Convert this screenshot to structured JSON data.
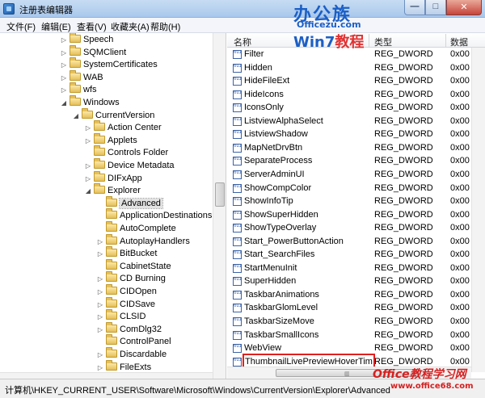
{
  "window": {
    "title": "注册表编辑器",
    "minimize_glyph": "—",
    "maximize_glyph": "□",
    "close_glyph": "✕"
  },
  "watermark": {
    "logo_top": "办公族",
    "logo_url": "Officezu.com",
    "logo_win7": "Win7",
    "logo_win7_suffix": "教程",
    "bottom_brand": "Office教程学习网",
    "bottom_url": "www.office68.com"
  },
  "menu": [
    "文件(F)",
    "编辑(E)",
    "查看(V)",
    "收藏夹(A)",
    "帮助(H)"
  ],
  "tree": [
    {
      "label": "Speech",
      "depth": 0,
      "arrow": "▷"
    },
    {
      "label": "SQMClient",
      "depth": 0,
      "arrow": "▷"
    },
    {
      "label": "SystemCertificates",
      "depth": 0,
      "arrow": "▷"
    },
    {
      "label": "WAB",
      "depth": 0,
      "arrow": "▷"
    },
    {
      "label": "wfs",
      "depth": 0,
      "arrow": "▷"
    },
    {
      "label": "Windows",
      "depth": 0,
      "arrow": "◢"
    },
    {
      "label": "CurrentVersion",
      "depth": 1,
      "arrow": "◢"
    },
    {
      "label": "Action Center",
      "depth": 2,
      "arrow": "▷"
    },
    {
      "label": "Applets",
      "depth": 2,
      "arrow": "▷"
    },
    {
      "label": "Controls Folder",
      "depth": 2,
      "arrow": ""
    },
    {
      "label": "Device Metadata",
      "depth": 2,
      "arrow": "▷"
    },
    {
      "label": "DIFxApp",
      "depth": 2,
      "arrow": "▷"
    },
    {
      "label": "Explorer",
      "depth": 2,
      "arrow": "◢"
    },
    {
      "label": "Advanced",
      "depth": 3,
      "arrow": "",
      "selected": true
    },
    {
      "label": "ApplicationDestinations",
      "depth": 3,
      "arrow": ""
    },
    {
      "label": "AutoComplete",
      "depth": 3,
      "arrow": ""
    },
    {
      "label": "AutoplayHandlers",
      "depth": 3,
      "arrow": "▷"
    },
    {
      "label": "BitBucket",
      "depth": 3,
      "arrow": "▷"
    },
    {
      "label": "CabinetState",
      "depth": 3,
      "arrow": ""
    },
    {
      "label": "CD Burning",
      "depth": 3,
      "arrow": "▷"
    },
    {
      "label": "CIDOpen",
      "depth": 3,
      "arrow": "▷"
    },
    {
      "label": "CIDSave",
      "depth": 3,
      "arrow": "▷"
    },
    {
      "label": "CLSID",
      "depth": 3,
      "arrow": "▷"
    },
    {
      "label": "ComDlg32",
      "depth": 3,
      "arrow": "▷"
    },
    {
      "label": "ControlPanel",
      "depth": 3,
      "arrow": ""
    },
    {
      "label": "Discardable",
      "depth": 3,
      "arrow": "▷"
    },
    {
      "label": "FileExts",
      "depth": 3,
      "arrow": "▷"
    }
  ],
  "list": {
    "columns": {
      "name": "名称",
      "type": "类型",
      "data": "数据"
    },
    "rows": [
      {
        "name": "Filter",
        "type": "REG_DWORD",
        "data": "0x00"
      },
      {
        "name": "Hidden",
        "type": "REG_DWORD",
        "data": "0x00"
      },
      {
        "name": "HideFileExt",
        "type": "REG_DWORD",
        "data": "0x00"
      },
      {
        "name": "HideIcons",
        "type": "REG_DWORD",
        "data": "0x00"
      },
      {
        "name": "IconsOnly",
        "type": "REG_DWORD",
        "data": "0x00"
      },
      {
        "name": "ListviewAlphaSelect",
        "type": "REG_DWORD",
        "data": "0x00"
      },
      {
        "name": "ListviewShadow",
        "type": "REG_DWORD",
        "data": "0x00"
      },
      {
        "name": "MapNetDrvBtn",
        "type": "REG_DWORD",
        "data": "0x00"
      },
      {
        "name": "SeparateProcess",
        "type": "REG_DWORD",
        "data": "0x00"
      },
      {
        "name": "ServerAdminUI",
        "type": "REG_DWORD",
        "data": "0x00"
      },
      {
        "name": "ShowCompColor",
        "type": "REG_DWORD",
        "data": "0x00"
      },
      {
        "name": "ShowInfoTip",
        "type": "REG_DWORD",
        "data": "0x00"
      },
      {
        "name": "ShowSuperHidden",
        "type": "REG_DWORD",
        "data": "0x00"
      },
      {
        "name": "ShowTypeOverlay",
        "type": "REG_DWORD",
        "data": "0x00"
      },
      {
        "name": "Start_PowerButtonAction",
        "type": "REG_DWORD",
        "data": "0x00"
      },
      {
        "name": "Start_SearchFiles",
        "type": "REG_DWORD",
        "data": "0x00"
      },
      {
        "name": "StartMenuInit",
        "type": "REG_DWORD",
        "data": "0x00"
      },
      {
        "name": "SuperHidden",
        "type": "REG_DWORD",
        "data": "0x00"
      },
      {
        "name": "TaskbarAnimations",
        "type": "REG_DWORD",
        "data": "0x00"
      },
      {
        "name": "TaskbarGlomLevel",
        "type": "REG_DWORD",
        "data": "0x00"
      },
      {
        "name": "TaskbarSizeMove",
        "type": "REG_DWORD",
        "data": "0x00"
      },
      {
        "name": "TaskbarSmallIcons",
        "type": "REG_DWORD",
        "data": "0x00"
      },
      {
        "name": "WebView",
        "type": "REG_DWORD",
        "data": "0x00"
      },
      {
        "name": "ThumbnailLivePreviewHoverTim",
        "type": "REG_DWORD",
        "data": "0x00",
        "highlight": true
      }
    ]
  },
  "status": {
    "path": "计算机\\HKEY_CURRENT_USER\\Software\\Microsoft\\Windows\\CurrentVersion\\Explorer\\Advanced"
  },
  "colors": {
    "highlight_border": "#e02020",
    "titlebar": "#a9c8ec"
  }
}
